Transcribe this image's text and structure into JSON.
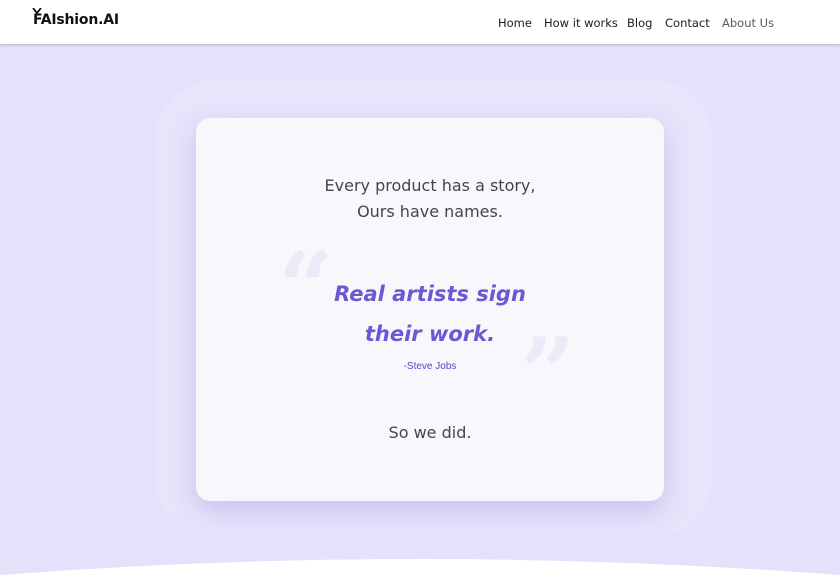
{
  "header": {
    "logo_text": "FAIshion.AI",
    "nav": {
      "home": "Home",
      "how_it_works": "How it works",
      "blog": "Blog",
      "contact": "Contact",
      "about_us": "About Us"
    }
  },
  "card": {
    "intro_line1": "Every product has a story,",
    "intro_line2": "Ours have names.",
    "quote_line1": "Real artists sign",
    "quote_line2": "their work.",
    "author": "-Steve Jobs",
    "outro": "So we did."
  },
  "colors": {
    "page_background": "#e4e2fb",
    "card_background": "#f8f7fc",
    "quote_accent": "#6a59d3",
    "author_text": "#5246c4",
    "body_text": "#454552"
  }
}
